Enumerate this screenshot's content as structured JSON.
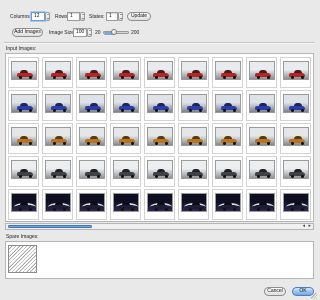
{
  "controls": {
    "columns_label": "Columns:",
    "columns_value": "12",
    "rows_label": "Rows:",
    "rows_value": "1",
    "states_label": "States:",
    "states_value": "1",
    "update_label": "Update",
    "add_images_label": "Add Images",
    "image_size_label": "Image Size:",
    "image_size_value": "100",
    "slider_min": "20",
    "slider_max": "200",
    "slider_fraction": 0.44
  },
  "input_images": {
    "label": "Input Images:",
    "rows": [
      {
        "car_color": "#b72424",
        "bg_top": "#e9ecef",
        "bg_bottom": "#8a8e93",
        "roof": "#4a1a1a",
        "light": false
      },
      {
        "car_color": "#2b3ea8",
        "bg_top": "#dfe3e8",
        "bg_bottom": "#7c8188",
        "roof": "#1d2460",
        "light": false
      },
      {
        "car_color": "#b8741e",
        "bg_top": "#e4e6e8",
        "bg_bottom": "#85898e",
        "roof": "#5b3a10",
        "light": false
      },
      {
        "car_color": "#3e4147",
        "bg_top": "#eceef0",
        "bg_bottom": "#8f9398",
        "roof": "#1f2024",
        "light": false
      },
      {
        "car_color": "#1a1d33",
        "bg_top": "#0e1021",
        "bg_bottom": "#2b2650",
        "roof": "#0b0c18",
        "light": true
      }
    ],
    "columns": 9,
    "scroll_fraction": 0.28,
    "scroll_left_arrow": "◂",
    "scroll_right_arrow": "▸"
  },
  "spare_images": {
    "label": "Spare Images:"
  },
  "buttons": {
    "cancel": "Cancel",
    "ok": "OK"
  }
}
